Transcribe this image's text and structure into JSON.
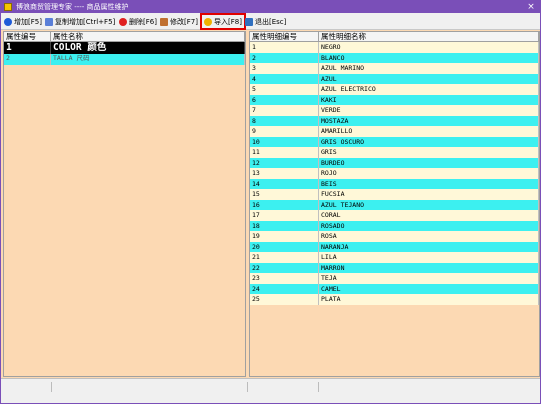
{
  "window": {
    "title": "博浪商贸管理专家 ---- 商品属性维护",
    "close_glyph": "×"
  },
  "toolbar": {
    "add_label": "增加[F5]",
    "copy_add_label": "复制增加[Ctrl+F5]",
    "delete_label": "删除[F6]",
    "edit_label": "修改[F7]",
    "import_label": "导入[F8]",
    "exit_label": "退出[Esc]"
  },
  "left_grid": {
    "headers": [
      "属性编号",
      "属性名称"
    ],
    "rows": [
      {
        "code": "1",
        "name": "COLOR 颜色"
      },
      {
        "code": "2",
        "name": "TALLA 尺码"
      }
    ]
  },
  "right_grid": {
    "headers": [
      "属性明细编号",
      "属性明细名称"
    ],
    "rows": [
      {
        "code": "1",
        "name": "NEGRO"
      },
      {
        "code": "2",
        "name": "BLANCO"
      },
      {
        "code": "3",
        "name": "AZUL MARINO"
      },
      {
        "code": "4",
        "name": "AZUL"
      },
      {
        "code": "5",
        "name": "AZUL ELECTRICO"
      },
      {
        "code": "6",
        "name": "KAKI"
      },
      {
        "code": "7",
        "name": "VERDE"
      },
      {
        "code": "8",
        "name": "MOSTAZA"
      },
      {
        "code": "9",
        "name": "AMARILLO"
      },
      {
        "code": "10",
        "name": "GRIS OSCURO"
      },
      {
        "code": "11",
        "name": "GRIS"
      },
      {
        "code": "12",
        "name": "BURDEO"
      },
      {
        "code": "13",
        "name": "ROJO"
      },
      {
        "code": "14",
        "name": "BEIS"
      },
      {
        "code": "15",
        "name": "FUCSIA"
      },
      {
        "code": "16",
        "name": "AZUL TEJANO"
      },
      {
        "code": "17",
        "name": "CORAL"
      },
      {
        "code": "18",
        "name": "ROSADO"
      },
      {
        "code": "19",
        "name": "ROSA"
      },
      {
        "code": "20",
        "name": "NARANJA"
      },
      {
        "code": "21",
        "name": "LILA"
      },
      {
        "code": "22",
        "name": "MARRON"
      },
      {
        "code": "23",
        "name": "TEJA"
      },
      {
        "code": "24",
        "name": "CAMEL"
      },
      {
        "code": "25",
        "name": "PLATA"
      }
    ]
  },
  "colors": {
    "title_bar": "#7a4fb8",
    "panel_background": "#fcd9b3",
    "row_odd": "#fff8d8",
    "row_even": "#3cf0f0",
    "highlight_border": "#e00000"
  },
  "icons": {
    "add": "add-icon",
    "copy_add": "copy-add-icon",
    "delete": "delete-icon",
    "edit": "edit-icon",
    "import": "import-icon",
    "exit": "exit-icon"
  }
}
